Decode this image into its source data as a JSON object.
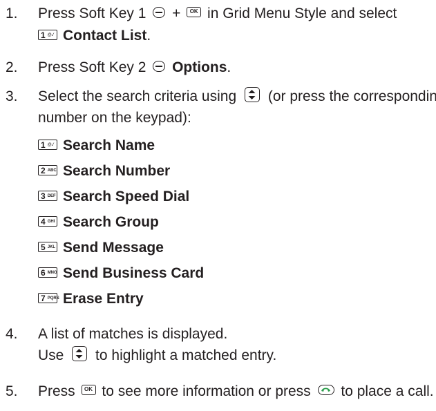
{
  "steps": [
    {
      "number": "1.",
      "line1_pre": "Press Soft Key 1",
      "line1_plus": "+",
      "line1_post": "in Grid Menu Style and select",
      "key_label": "1",
      "item": "Contact List",
      "item_suffix": "."
    },
    {
      "number": "2.",
      "pre": "Press Soft Key 2",
      "bold": "Options",
      "post": "."
    },
    {
      "number": "3.",
      "line1_pre": "Select the search criteria using",
      "line1_post": "(or press the corresponding",
      "line2": "number on the keypad):",
      "options": [
        {
          "key": "1",
          "sub": "@.⁄",
          "label": "Search Name"
        },
        {
          "key": "2",
          "sub": "ABC",
          "label": "Search Number"
        },
        {
          "key": "3",
          "sub": "DEF",
          "label": "Search Speed Dial"
        },
        {
          "key": "4",
          "sub": "GHI",
          "label": "Search Group"
        },
        {
          "key": "5",
          "sub": "JKL",
          "label": "Send Message"
        },
        {
          "key": "6",
          "sub": "MNO",
          "label": "Send Business Card"
        },
        {
          "key": "7",
          "sub": "PQRS",
          "label": "Erase Entry"
        }
      ]
    },
    {
      "number": "4.",
      "line1": "A list of matches is displayed.",
      "line2_pre": "Use",
      "line2_post": "to highlight a matched entry."
    },
    {
      "number": "5.",
      "pre": "Press",
      "mid": "to see more information or press",
      "post": "to place a call."
    }
  ],
  "icons": {
    "ok_label": "OK",
    "send_color": "#2a9d4a"
  }
}
